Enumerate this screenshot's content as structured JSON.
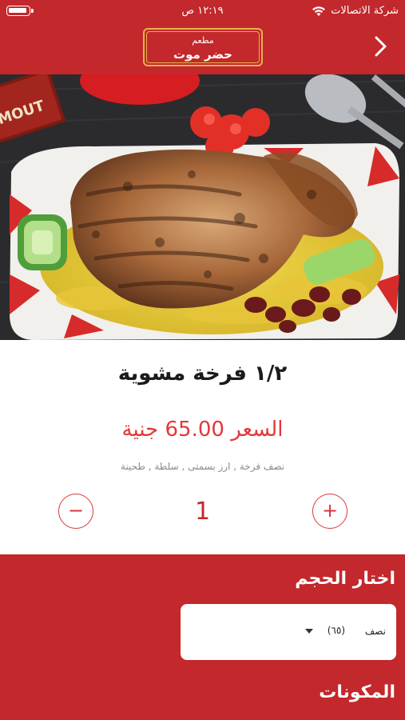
{
  "status_bar": {
    "time": "١٢:١٩ ص",
    "carrier": "شركة الاتصالات",
    "wifi_icon": "wifi-icon",
    "battery_icon": "battery-icon"
  },
  "header": {
    "back_icon": "chevron-right-icon",
    "restaurant_prefix": "مطعم",
    "restaurant_name": "حضر موت",
    "accent_color": "#c3282c",
    "border_color": "#e7b24a"
  },
  "hero_image": {
    "sign_text": "MOUT",
    "description_icon": "food-photo"
  },
  "product": {
    "title": "١/٢ فرخة مشوية",
    "price_text": "السعر 65.00 جنية",
    "price_color": "#e3373a",
    "ingredients": "نصف فرخة , ارز بسمتى , سلطة , طحينة"
  },
  "quantity": {
    "minus_label": "−",
    "value": "1",
    "plus_label": "+"
  },
  "options": {
    "size_label": "اختار الحجم",
    "selected_size_name": "نصف",
    "selected_size_price": "(٦٥)",
    "components_label": "المكونات"
  }
}
